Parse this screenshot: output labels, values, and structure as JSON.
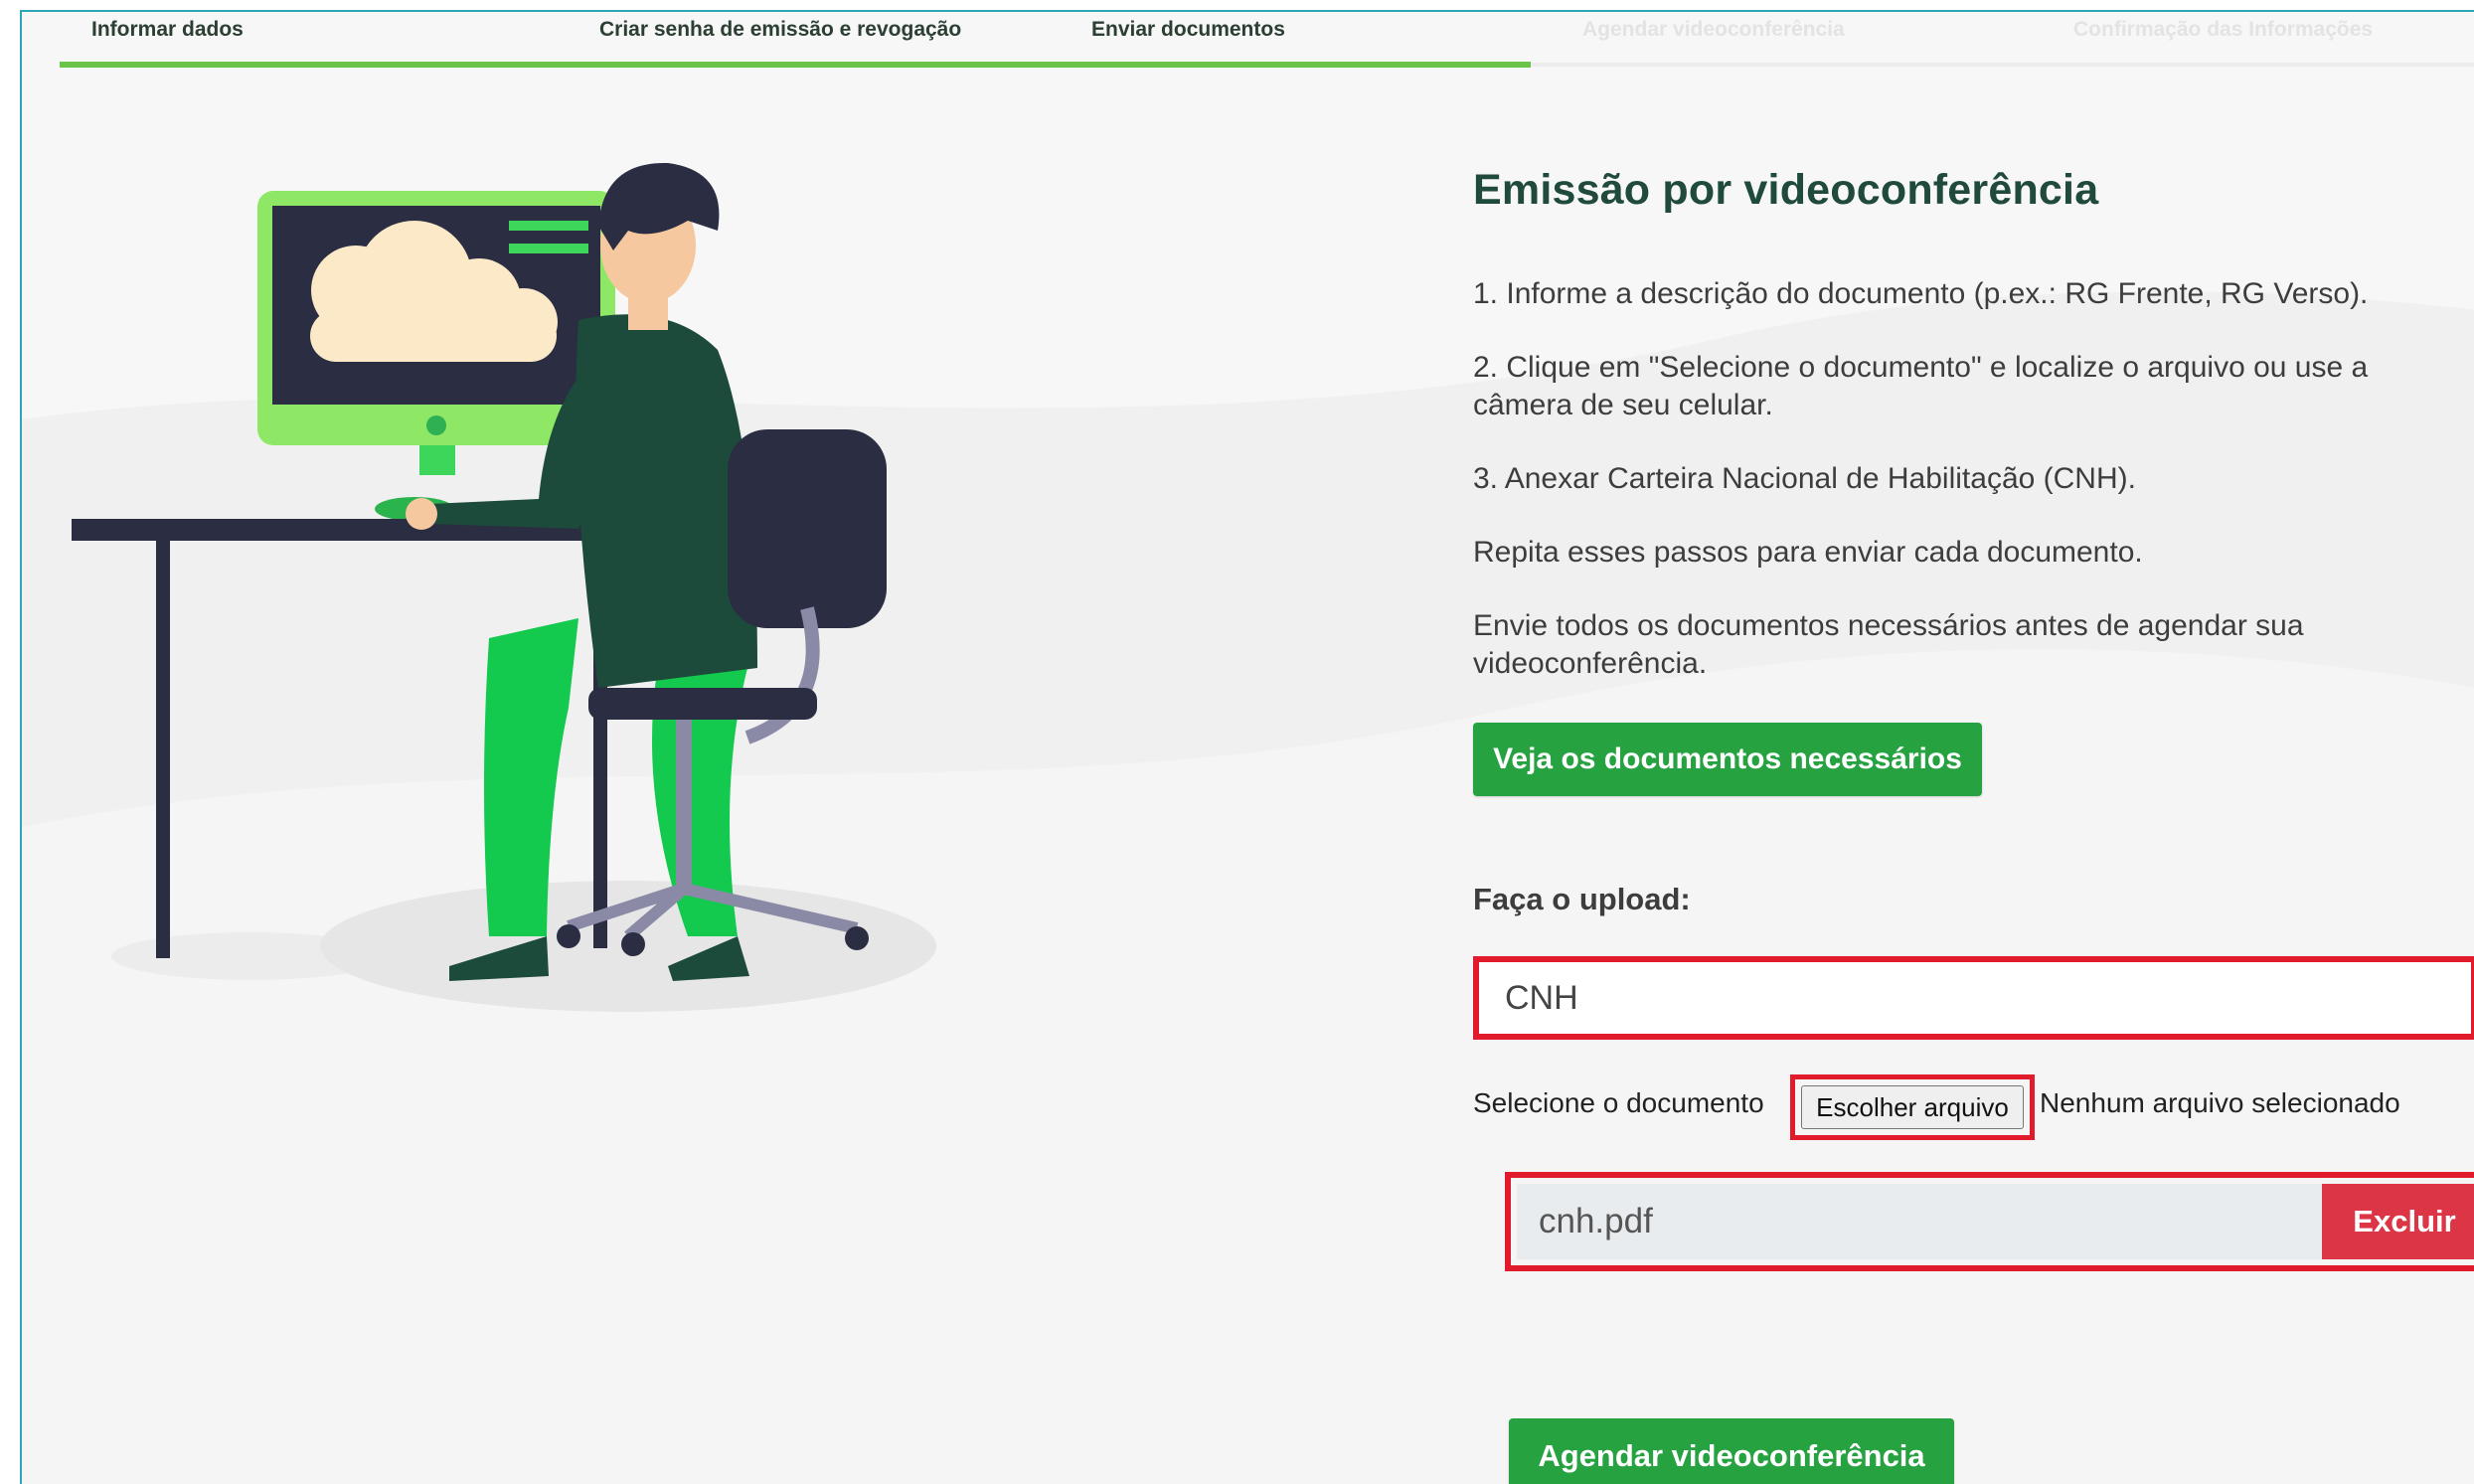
{
  "stepper": {
    "steps": [
      {
        "label": "Informar dados",
        "state": "done"
      },
      {
        "label": "Criar senha de emissão e revogação",
        "state": "done"
      },
      {
        "label": "Enviar documentos",
        "state": "current"
      },
      {
        "label": "Agendar videoconferência",
        "state": "pending"
      },
      {
        "label": "Confirmação das Informações",
        "state": "pending"
      }
    ]
  },
  "main": {
    "title": "Emissão por videoconferência",
    "instructions": [
      "1. Informe a descrição do documento (p.ex.: RG Frente, RG Verso).",
      "2. Clique em \"Selecione o documento\" e localize o arquivo ou use a câmera de seu celular.",
      "3. Anexar Carteira Nacional de Habilitação (CNH).",
      "Repita esses passos para enviar cada documento.",
      "Envie todos os documentos necessários antes de agendar sua videoconferência."
    ],
    "docs_button": "Veja os documentos necessários"
  },
  "upload": {
    "label": "Faça o upload:",
    "description_value": "CNH",
    "select_label": "Selecione o documento",
    "choose_file_button": "Escolher arquivo",
    "no_file_text": "Nenhum arquivo selecionado",
    "uploaded_file": "cnh.pdf",
    "delete_button": "Excluir"
  },
  "actions": {
    "schedule_button": "Agendar videoconferência"
  },
  "colors": {
    "accent_green": "#26a241",
    "progress_green": "#6ac44a",
    "danger_red": "#dc3545",
    "highlight_red": "#e11b2c",
    "title_dark_green": "#1f4a3c"
  },
  "icons": [
    "cloud-icon",
    "person-at-computer-illustration"
  ]
}
